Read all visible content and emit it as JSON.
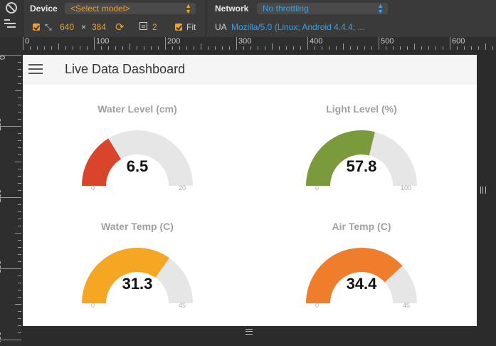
{
  "devtools": {
    "device_label": "Device",
    "device_select": "<Select model>",
    "network_label": "Network",
    "network_select": "No throttling",
    "width": "640",
    "times": "×",
    "height": "384",
    "scale": "2",
    "fit_label": "Fit",
    "ua_label": "UA",
    "ua_value": "Mozilla/5.0 (Linux; Android 4.4.4; ..."
  },
  "ruler": {
    "top": [
      "0",
      "100",
      "200",
      "300",
      "400",
      "500",
      "600"
    ],
    "left": [
      "0",
      "100",
      "200",
      "300",
      "400"
    ]
  },
  "app": {
    "title": "Live Data Dashboard"
  },
  "gauges": [
    {
      "title": "Water Level (cm)",
      "value": "6.5",
      "min": "0",
      "max": "20",
      "fraction": 0.325,
      "color": "#d9452a"
    },
    {
      "title": "Light Level (%)",
      "value": "57.8",
      "min": "0",
      "max": "100",
      "fraction": 0.578,
      "color": "#7a9a3c"
    },
    {
      "title": "Water Temp (C)",
      "value": "31.3",
      "min": "0",
      "max": "45",
      "fraction": 0.6956,
      "color": "#f5a623"
    },
    {
      "title": "Air Temp (C)",
      "value": "34.4",
      "min": "0",
      "max": "45",
      "fraction": 0.7644,
      "color": "#ef7d2b"
    }
  ],
  "colors": {
    "track": "#e6e6e6",
    "accent_orange": "#f0a030",
    "accent_blue": "#37a3e8"
  }
}
